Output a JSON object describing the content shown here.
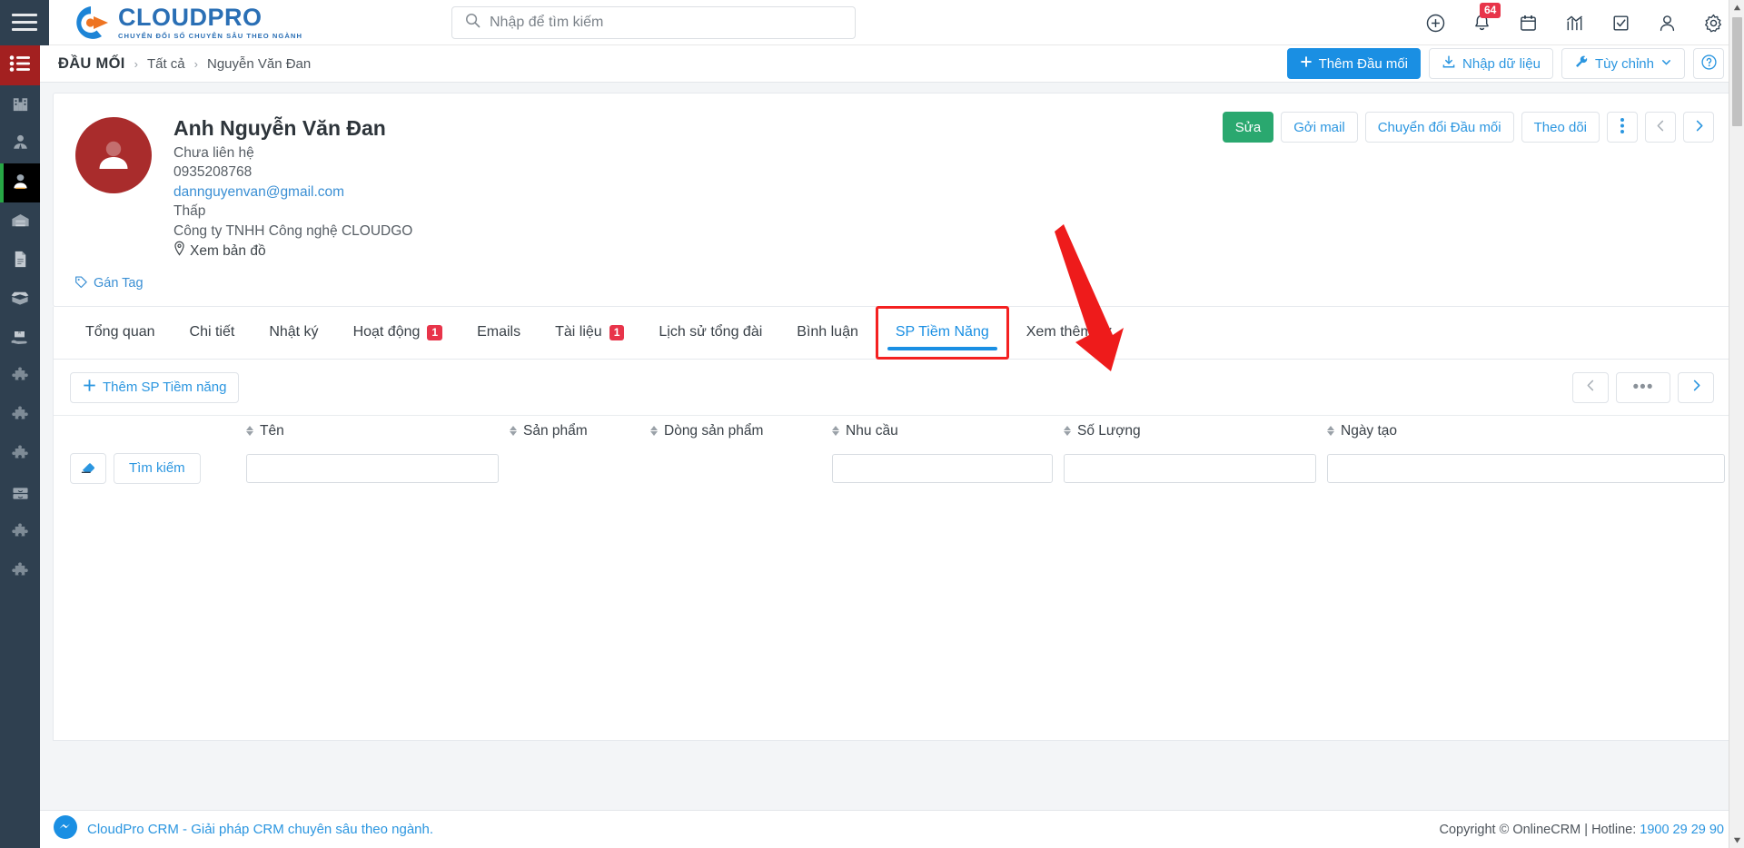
{
  "topbar": {
    "menu_icon": "hamburger-icon",
    "brand": {
      "title": "CLOUDPRO",
      "subtitle": "CHUYỂN ĐỔI SỐ CHUYÊN SÂU THEO NGÀNH"
    },
    "search": {
      "value": "",
      "placeholder": "Nhập để tìm kiếm",
      "icon": "search-icon",
      "caret": "chevron-down-icon"
    },
    "icons": [
      {
        "name": "plus-circle-icon",
        "badge": ""
      },
      {
        "name": "bell-icon",
        "badge": "64"
      },
      {
        "name": "calendar-icon",
        "badge": ""
      },
      {
        "name": "analytics-icon",
        "badge": ""
      },
      {
        "name": "task-check-icon",
        "badge": ""
      },
      {
        "name": "user-icon",
        "badge": ""
      },
      {
        "name": "gear-icon",
        "badge": ""
      }
    ]
  },
  "rail": {
    "top_icon": "list-menu-icon",
    "items": [
      {
        "icon": "building-icon",
        "active": false
      },
      {
        "icon": "contacts-icon",
        "active": false
      },
      {
        "icon": "lead-person-icon",
        "active": true
      },
      {
        "icon": "warehouse-icon",
        "active": false
      },
      {
        "icon": "document-icon",
        "active": false
      },
      {
        "icon": "open-box-icon",
        "active": false
      },
      {
        "icon": "box-hand-icon",
        "active": false
      },
      {
        "icon": "puzzle-icon",
        "active": false
      },
      {
        "icon": "puzzle-icon",
        "active": false
      },
      {
        "icon": "puzzle-icon",
        "active": false
      },
      {
        "icon": "drawer-icon",
        "active": false
      },
      {
        "icon": "puzzle-icon",
        "active": false
      },
      {
        "icon": "puzzle-icon",
        "active": false
      }
    ]
  },
  "breadcrumb": {
    "root": "ĐẦU MỐI",
    "separator": "›",
    "items": [
      "Tất cả",
      "Nguyễn Văn Đan"
    ],
    "actions": [
      {
        "label": "Thêm Đầu mối",
        "icon": "plus-icon",
        "style": "primary"
      },
      {
        "label": "Nhập dữ liệu",
        "icon": "import-icon",
        "style": "default"
      },
      {
        "label": "Tùy chỉnh",
        "icon": "wrench-icon",
        "style": "default",
        "caret": "chevron-down-icon"
      },
      {
        "label": "",
        "icon": "help-circle-icon",
        "style": "icon-only"
      }
    ]
  },
  "profile": {
    "avatar_icon": "user-avatar-icon",
    "name": "Anh Nguyễn Văn Đan",
    "status": "Chưa liên hệ",
    "phone": "0935208768",
    "email": "dannguyenvan@gmail.com",
    "rating": "Thấp",
    "company": "Công ty TNHH Công nghệ CLOUDGO",
    "map_link": "Xem bản đồ",
    "map_icon": "map-pin-icon",
    "tag_link": "Gán Tag",
    "tag_icon": "tag-icon",
    "actions": [
      {
        "label": "Sửa",
        "style": "green"
      },
      {
        "label": "Gởi mail",
        "style": "default"
      },
      {
        "label": "Chuyển đổi Đầu mối",
        "style": "default"
      },
      {
        "label": "Theo dõi",
        "style": "default"
      }
    ],
    "more_icon": "vertical-dots-icon",
    "prev_icon": "chevron-left-icon",
    "next_icon": "chevron-right-icon"
  },
  "tabs": [
    {
      "label": "Tổng quan",
      "badge": "",
      "active": false
    },
    {
      "label": "Chi tiết",
      "badge": "",
      "active": false
    },
    {
      "label": "Nhật ký",
      "badge": "",
      "active": false
    },
    {
      "label": "Hoạt động",
      "badge": "1",
      "active": false
    },
    {
      "label": "Emails",
      "badge": "",
      "active": false
    },
    {
      "label": "Tài liệu",
      "badge": "1",
      "active": false
    },
    {
      "label": "Lịch sử tổng đài",
      "badge": "",
      "active": false
    },
    {
      "label": "Bình luận",
      "badge": "",
      "active": false
    },
    {
      "label": "SP Tiềm Năng",
      "badge": "",
      "active": true
    },
    {
      "label": "Xem thêm",
      "badge": "",
      "active": false,
      "caret": "chevron-down-icon"
    }
  ],
  "panel": {
    "add_button": {
      "label": "Thêm SP Tiềm năng",
      "icon": "plus-icon"
    },
    "pager": {
      "prev_icon": "chevron-left-icon",
      "more_label": "•••",
      "next_icon": "chevron-right-icon"
    },
    "columns": [
      {
        "label": "",
        "sortable": false
      },
      {
        "label": "Tên",
        "sortable": true
      },
      {
        "label": "Sản phẩm",
        "sortable": true
      },
      {
        "label": "Dòng sản phẩm",
        "sortable": true
      },
      {
        "label": "Nhu cầu",
        "sortable": true
      },
      {
        "label": "Số Lượng",
        "sortable": true
      },
      {
        "label": "Ngày tạo",
        "sortable": true
      }
    ],
    "filter_row": {
      "clear_icon": "eraser-icon",
      "search_label": "Tìm kiếm",
      "inputs": [
        "",
        "",
        "",
        "",
        "",
        ""
      ]
    },
    "rows": []
  },
  "footer": {
    "messenger_icon": "messenger-icon",
    "left_text": "CloudPro CRM - Giải pháp CRM chuyên sâu theo ngành.",
    "copyright": "Copyright © OnlineCRM | Hotline: ",
    "hotline": "1900 29 29 90"
  },
  "annotation": {
    "arrow_icon": "red-arrow-down-icon",
    "arrow_color": "#ee1b1b",
    "highlight_color": "#f42121"
  },
  "colors": {
    "brand_blue": "#2a6fb5",
    "accent_blue": "#1a8fe3",
    "link_blue": "#2b96e0",
    "green": "#2aa86f",
    "red_badge": "#e8344a",
    "rail_dark": "#2f4050",
    "rail_red": "#a32020",
    "avatar_red": "#a92c2c"
  }
}
